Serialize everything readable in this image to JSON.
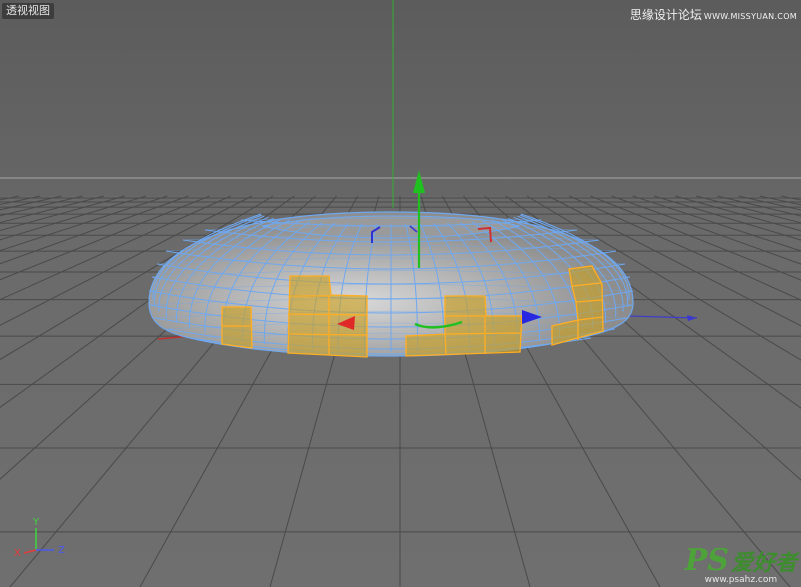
{
  "viewport": {
    "label": "透视视图",
    "background_top": "#5b5b5b",
    "background_bottom": "#707070",
    "horizon_color": "#a6a6a6"
  },
  "watermark": {
    "site_name": "思缘设计论坛",
    "site_url": "WWW.MISSYUAN.COM"
  },
  "axis_indicator": {
    "y_label": "Y",
    "x_label": "X",
    "z_label": "Z",
    "y_color": "#3fd63f",
    "x_color": "#e23b3b",
    "z_color": "#4a58f0"
  },
  "logo": {
    "ps_text": "PS",
    "cn_text": "爱好者",
    "url_text": "www.psahz.com"
  },
  "colors": {
    "wire_unselected": "#6fa8f0",
    "wire_selected": "#ffae22",
    "fill_selected": "#c9a12c",
    "gizmo_y": "#20c020",
    "gizmo_x": "#e02828",
    "gizmo_z": "#2828e0",
    "grid": "#4a4a4a"
  },
  "scene": {
    "object_name": "torus",
    "tool": "move-tool",
    "mode": "polygon-selection"
  }
}
